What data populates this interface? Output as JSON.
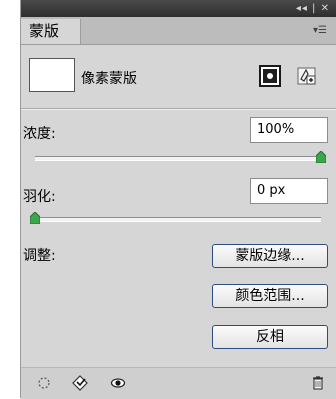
{
  "window": {
    "controls_text": "◂◂ | ✕"
  },
  "tab": {
    "label": "蒙版"
  },
  "mask": {
    "title": "像素蒙版"
  },
  "density": {
    "label": "浓度:",
    "value": "100%",
    "slider_level": 1.0
  },
  "feather": {
    "label": "羽化:",
    "value": "0 px",
    "slider_level": 0.0
  },
  "refine": {
    "label": "调整:",
    "mask_edge_button": "蒙版边缘...",
    "color_range_button": "颜色范围...",
    "invert_button": "反相"
  },
  "colors": {
    "panel_bg": "#d6d6d6",
    "titlebar_bg": "#3a3a3a",
    "button_border": "#2d4d80",
    "slider_thumb": "#3aa84a"
  },
  "icons": {
    "window_controls": "collapse-close-icons",
    "panel_menu": "panel-menu-icon",
    "add_pixel_mask": "pixel-mask-icon",
    "add_vector_mask": "vector-mask-icon",
    "load_selection": "load-selection-icon",
    "apply_mask": "apply-mask-icon",
    "visibility": "eye-icon",
    "delete": "trash-icon"
  }
}
